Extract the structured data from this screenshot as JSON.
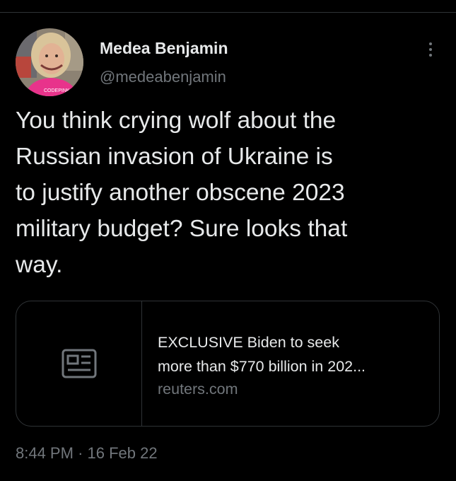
{
  "tweet": {
    "author": {
      "display_name": "Medea Benjamin",
      "handle": "@medeabenjamin",
      "avatar_shirt_text": "CODEPINK"
    },
    "text": "You think crying wolf about the\nRussian invasion of Ukraine is\nto justify another obscene 2023\nmilitary budget? Sure looks that\nway.",
    "link_card": {
      "icon": "news-article-icon",
      "title_line1": "EXCLUSIVE Biden to seek",
      "title_line2": "more than $770 billion in 202...",
      "domain": "reuters.com"
    },
    "time": "8:44 PM",
    "separator": "·",
    "date": "16 Feb 22"
  },
  "colors": {
    "background": "#000000",
    "primary_text": "#e7e9ea",
    "secondary_text": "#71767b",
    "border": "#2f3336",
    "avatar_shirt": "#e8338b"
  }
}
